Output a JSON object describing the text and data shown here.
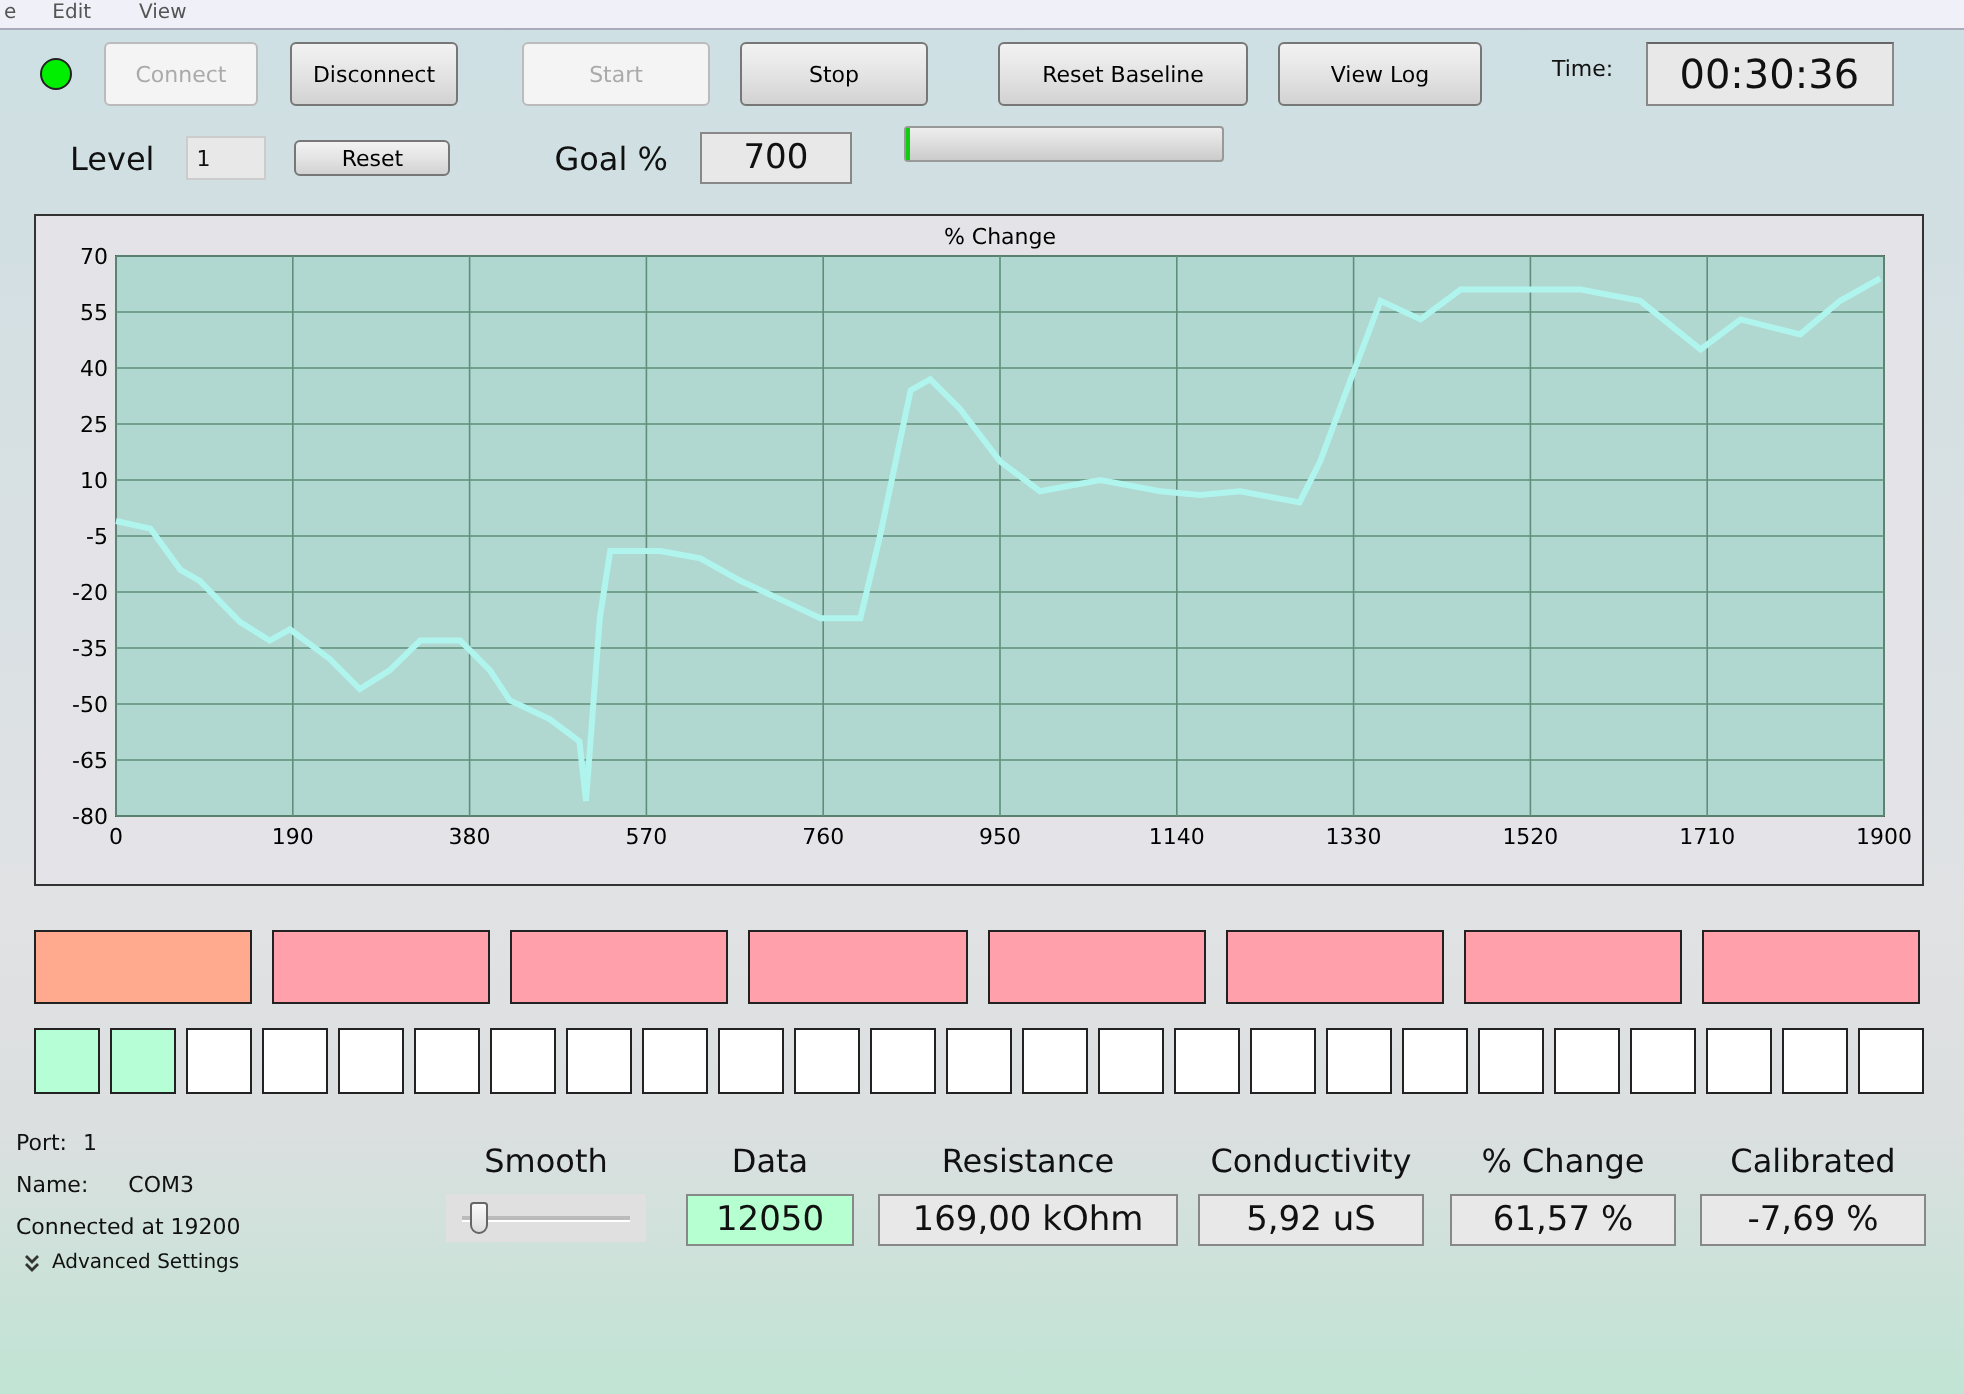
{
  "menu": [
    "e",
    "Edit",
    "View"
  ],
  "toolbar": {
    "connected": true,
    "buttons": [
      {
        "label": "Connect",
        "disabled": true
      },
      {
        "label": "Disconnect",
        "disabled": false
      },
      {
        "label": "Start",
        "disabled": true
      },
      {
        "label": "Stop",
        "disabled": false
      },
      {
        "label": "Reset Baseline",
        "disabled": false
      },
      {
        "label": "View Log",
        "disabled": false
      }
    ],
    "time_label": "Time:",
    "time": "00:30:36"
  },
  "level_row": {
    "label": "Level",
    "value": "1",
    "reset": "Reset",
    "goal_label": "Goal %",
    "goal": "700",
    "progress": {
      "level": 0.01
    }
  },
  "chart": {
    "chart_data": {
      "type": "line",
      "title": "% Change",
      "x": [
        0,
        37,
        69,
        90,
        133,
        165,
        187,
        230,
        262,
        294,
        327,
        370,
        402,
        423,
        466,
        498,
        505,
        520,
        531,
        585,
        628,
        671,
        714,
        757,
        800,
        821,
        854,
        875,
        907,
        950,
        993,
        1058,
        1122,
        1165,
        1208,
        1272,
        1294,
        1327,
        1359,
        1402,
        1445,
        1509,
        1574,
        1638,
        1703,
        1746,
        1810,
        1853,
        1896
      ],
      "grid": true,
      "series": [
        {
          "color": "#b0f4ee",
          "values": [
            -1,
            -3,
            -14,
            -17,
            -28,
            -33,
            -30,
            -38,
            -46,
            -41,
            -33,
            -33,
            -41,
            -49,
            -54,
            -60,
            -76,
            -27,
            -9,
            -9,
            -11,
            -17,
            -22,
            -27,
            -27,
            -5,
            34,
            37,
            29,
            15,
            7,
            10,
            7,
            6,
            7,
            4,
            15,
            37,
            58,
            53,
            61,
            61,
            61,
            58,
            45,
            53,
            49,
            58,
            64
          ]
        }
      ],
      "xlim": [
        0,
        1900
      ],
      "ylim": [
        -80,
        70
      ],
      "xticks": [
        0,
        190,
        380,
        570,
        760,
        950,
        1140,
        1330,
        1520,
        1710,
        1900
      ],
      "yticks": [
        -80,
        -65,
        -50,
        -35,
        -20,
        -5,
        10,
        25,
        40,
        55,
        70
      ]
    }
  },
  "zones": [
    {
      "color": "#ffaa8e"
    },
    {
      "color": "#ffa0aa"
    },
    {
      "color": "#ffa0aa"
    },
    {
      "color": "#ffa0aa"
    },
    {
      "color": "#ffa0aa"
    },
    {
      "color": "#ffa0aa"
    },
    {
      "color": "#ffa0aa"
    },
    {
      "color": "#ffa0aa"
    }
  ],
  "steps": [
    {
      "color": "#b6ffd6"
    },
    {
      "color": "#b6ffd6"
    },
    {
      "color": "#ffffff"
    },
    {
      "color": "#ffffff"
    },
    {
      "color": "#ffffff"
    },
    {
      "color": "#ffffff"
    },
    {
      "color": "#ffffff"
    },
    {
      "color": "#ffffff"
    },
    {
      "color": "#ffffff"
    },
    {
      "color": "#ffffff"
    },
    {
      "color": "#ffffff"
    },
    {
      "color": "#ffffff"
    },
    {
      "color": "#ffffff"
    },
    {
      "color": "#ffffff"
    },
    {
      "color": "#ffffff"
    },
    {
      "color": "#ffffff"
    },
    {
      "color": "#ffffff"
    },
    {
      "color": "#ffffff"
    },
    {
      "color": "#ffffff"
    },
    {
      "color": "#ffffff"
    },
    {
      "color": "#ffffff"
    },
    {
      "color": "#ffffff"
    },
    {
      "color": "#ffffff"
    },
    {
      "color": "#ffffff"
    },
    {
      "color": "#ffffff"
    }
  ],
  "connection": {
    "port_label": "Port:",
    "port": "1",
    "name_label": "Name:",
    "name": "COM3",
    "status": "Connected at 19200",
    "advanced": "Advanced Settings"
  },
  "smooth": {
    "label": "Smooth",
    "level": 0.05
  },
  "readouts": [
    {
      "label": "Data",
      "value": "12050",
      "highlight": true
    },
    {
      "label": "Resistance",
      "value": "169,00 kOhm",
      "highlight": false
    },
    {
      "label": "Conductivity",
      "value": "5,92 uS",
      "highlight": false
    },
    {
      "label": "% Change",
      "value": "61,57 %",
      "highlight": false
    },
    {
      "label": "Calibrated",
      "value": "-7,69 %",
      "highlight": false
    }
  ]
}
